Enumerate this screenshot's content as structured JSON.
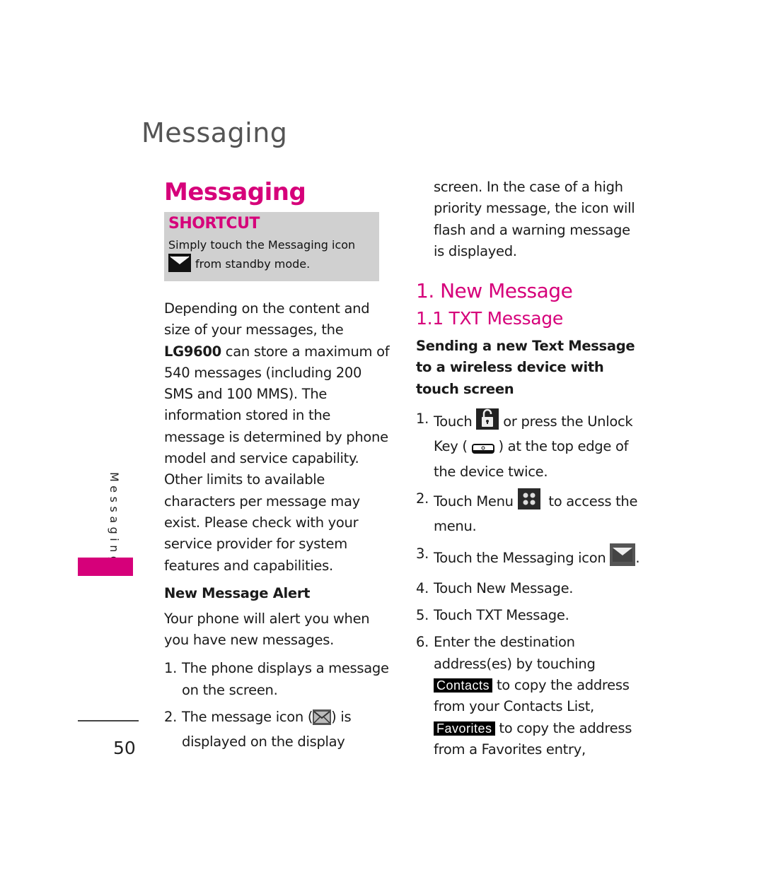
{
  "running_head": "Messaging",
  "side_label": "Messaging",
  "page_number": "50",
  "colors": {
    "accent": "#d6007a",
    "shortcut_bg": "#d0d0d0",
    "running_head": "#555555"
  },
  "left": {
    "section_title": "Messaging",
    "shortcut": {
      "title": "SHORTCUT",
      "line1": "Simply touch the Messaging icon",
      "icon": "envelope-icon",
      "line2": "from standby mode."
    },
    "intro_part1": "Depending on the content and size of your messages, the ",
    "intro_model": "LG9600",
    "intro_part2": " can store a maximum of 540 messages (including 200 SMS and 100 MMS). The information stored in the message is determined by phone model and service capability. Other limits to available characters per message may exist. Please check with your service provider for system features and capabilities.",
    "alert_heading": "New Message Alert",
    "alert_text": "Your phone will alert you when you have new messages.",
    "alert_steps": [
      {
        "num": "1.",
        "text": "The phone displays a message on the screen."
      },
      {
        "num": "2.",
        "text_before": "The message icon (",
        "icon": "message-status-icon",
        "text_after": ") is displayed on the display"
      }
    ]
  },
  "right": {
    "continued_text": "screen. In the case of a high priority message, the icon will flash and a warning message is displayed.",
    "heading1": "1. New Message",
    "heading2": "1.1 TXT Message",
    "intro": "Sending a new Text Message to a wireless device with touch screen",
    "steps": [
      {
        "num": "1.",
        "t1": "Touch ",
        "icon1": "unlock-icon",
        "t2": " or press the Unlock Key ( ",
        "icon2": "unlock-key-icon",
        "t3": " ) at the top edge of the device twice."
      },
      {
        "num": "2.",
        "t1": "Touch Menu ",
        "icon1": "menu-icon",
        "t2": "  to access the menu."
      },
      {
        "num": "3.",
        "t1": "Touch the Messaging icon ",
        "icon1": "envelope-icon",
        "t2": "."
      },
      {
        "num": "4.",
        "t1": "Touch ",
        "bold": "New Message",
        "t2": "."
      },
      {
        "num": "5.",
        "t1": "Touch ",
        "bold": "TXT Message",
        "t2": "."
      },
      {
        "num": "6.",
        "t1": "Enter the destination address(es) by touching ",
        "btn1": "Contacts",
        "t2": " to copy the address from your Contacts List, ",
        "btn2": "Favorites",
        "t3": " to copy the address from a Favorites entry,"
      }
    ]
  }
}
